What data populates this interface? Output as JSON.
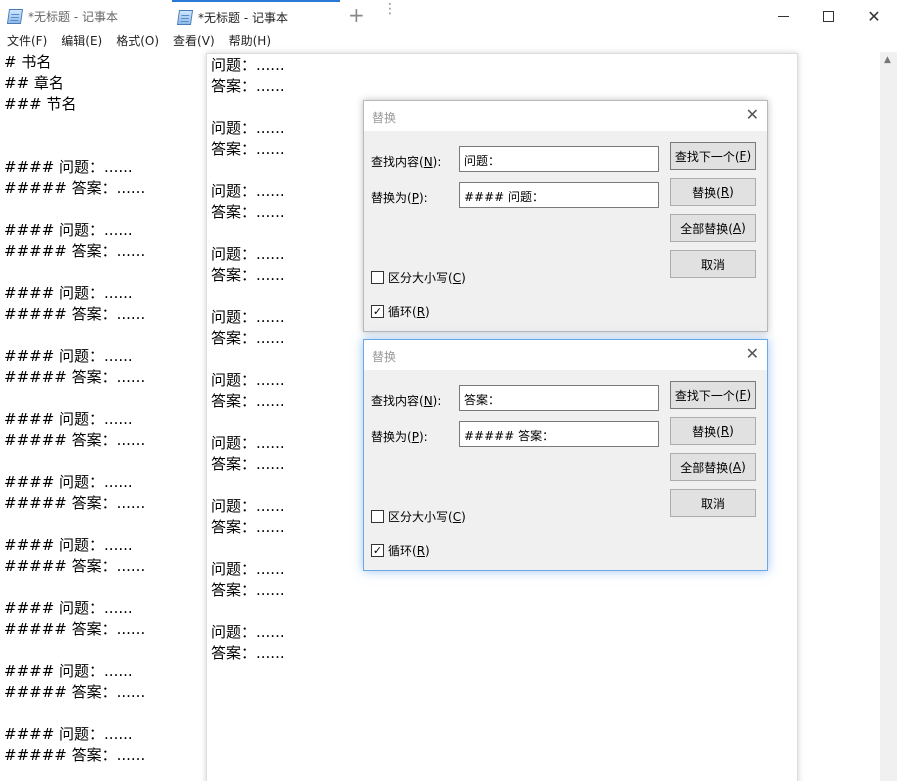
{
  "titlebar": {
    "tabs": [
      {
        "label": "*无标题 - 记事本",
        "active": false
      },
      {
        "label": "*无标题 - 记事本",
        "active": true
      }
    ],
    "add_tab": "+",
    "more": "⋮",
    "minimize": "—",
    "maximize": "☐",
    "close": "✕"
  },
  "menu": [
    {
      "label": "文件(F)"
    },
    {
      "label": "编辑(E)"
    },
    {
      "label": "格式(O)"
    },
    {
      "label": "查看(V)"
    },
    {
      "label": "帮助(H)"
    }
  ],
  "editor_left_lines": [
    "# 书名",
    "## 章名",
    "### 节名",
    "",
    "",
    "#### 问题：......",
    "##### 答案：......",
    "",
    "#### 问题：......",
    "##### 答案：......",
    "",
    "#### 问题：......",
    "##### 答案：......",
    "",
    "#### 问题：......",
    "##### 答案：......",
    "",
    "#### 问题：......",
    "##### 答案：......",
    "",
    "#### 问题：......",
    "##### 答案：......",
    "",
    "#### 问题：......",
    "##### 答案：......",
    "",
    "#### 问题：......",
    "##### 答案：......",
    "",
    "#### 问题：......",
    "##### 答案：......",
    "",
    "#### 问题：......",
    "##### 答案：......"
  ],
  "editor_right_lines": [
    "问题：......",
    "答案：......",
    "",
    "问题：......",
    "答案：......",
    "",
    "问题：......",
    "答案：......",
    "",
    "问题：......",
    "答案：......",
    "",
    "问题：......",
    "答案：......",
    "",
    "问题：......",
    "答案：......",
    "",
    "问题：......",
    "答案：......",
    "",
    "问题：......",
    "答案：......",
    "",
    "问题：......",
    "答案：......",
    "",
    "问题：......",
    "答案：......"
  ],
  "dialogs": [
    {
      "title": "替换",
      "close": "✕",
      "find_label": "查找内容(N):",
      "find_value": "问题：",
      "replace_label": "替换为(P):",
      "replace_value": "#### 问题：",
      "btn_find_next": "查找下一个(F)",
      "btn_replace": "替换(R)",
      "btn_replace_all": "全部替换(A)",
      "btn_cancel": "取消",
      "match_case_label": "区分大小写(C)",
      "match_case_checked": false,
      "wrap_label": "循环(R)",
      "wrap_checked": true
    },
    {
      "title": "替换",
      "close": "✕",
      "find_label": "查找内容(N):",
      "find_value": "答案：",
      "replace_label": "替换为(P):",
      "replace_value": "##### 答案：",
      "btn_find_next": "查找下一个(F)",
      "btn_replace": "替换(R)",
      "btn_replace_all": "全部替换(A)",
      "btn_cancel": "取消",
      "match_case_label": "区分大小写(C)",
      "match_case_checked": false,
      "wrap_label": "循环(R)",
      "wrap_checked": true
    }
  ],
  "colors": {
    "accent": "#2b79d6",
    "dialog_bg": "#f0f0f0",
    "button_bg": "#e1e1e1"
  }
}
